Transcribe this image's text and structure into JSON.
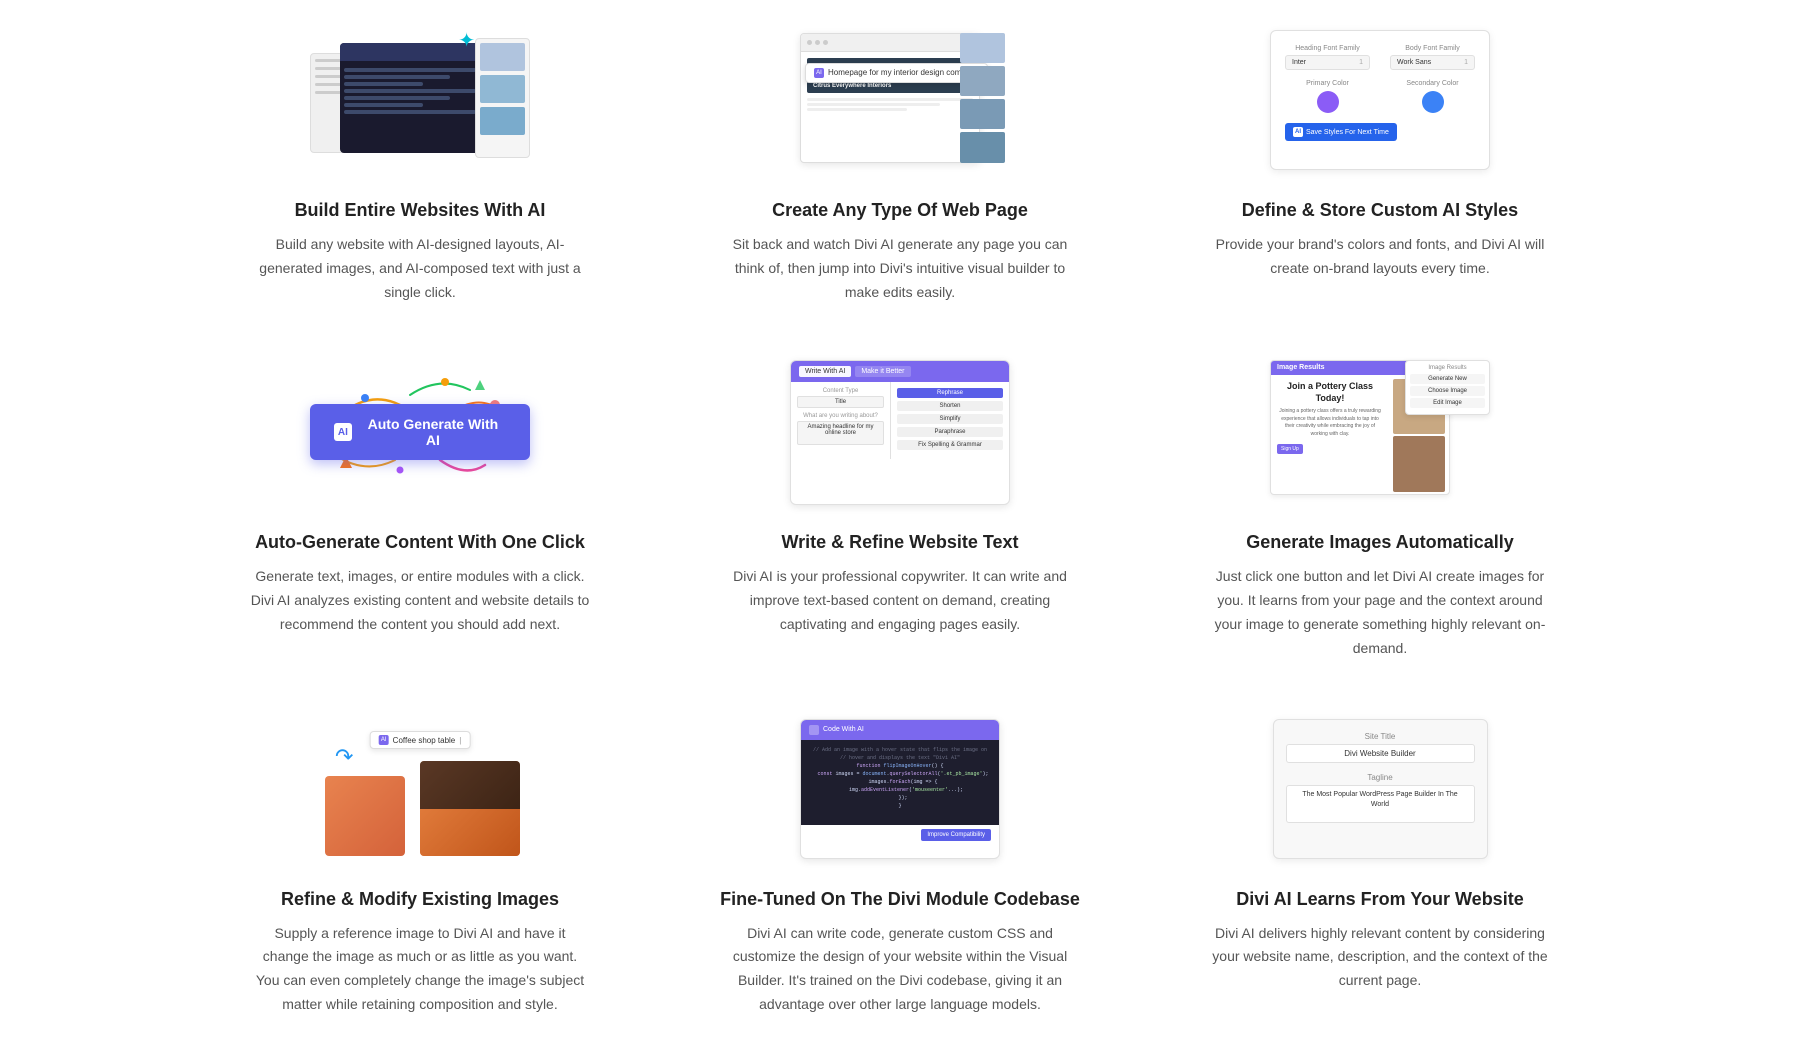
{
  "cards": [
    {
      "id": "build-websites",
      "title": "Build Entire Websites With AI",
      "description": "Build any website with AI-designed layouts, AI-generated images, and AI-composed text with just a single click."
    },
    {
      "id": "create-webpage",
      "title": "Create Any Type Of Web Page",
      "description": "Sit back and watch Divi AI generate any page you can think of, then jump into Divi's intuitive visual builder to make edits easily."
    },
    {
      "id": "define-styles",
      "title": "Define & Store Custom AI Styles",
      "description": "Provide your brand's colors and fonts, and Divi AI will create on-brand layouts every time."
    },
    {
      "id": "auto-generate",
      "title": "Auto-Generate Content With One Click",
      "description": "Generate text, images, or entire modules with a click. Divi AI analyzes existing content and website details to recommend the content you should add next."
    },
    {
      "id": "write-refine",
      "title": "Write & Refine Website Text",
      "description": "Divi AI is your professional copywriter. It can write and improve text-based content on demand, creating captivating and engaging pages easily."
    },
    {
      "id": "generate-images",
      "title": "Generate Images Automatically",
      "description": "Just click one button and let Divi AI create images for you. It learns from your page and the context around your image to generate something highly relevant on-demand."
    },
    {
      "id": "refine-images",
      "title": "Refine & Modify Existing Images",
      "description": "Supply a reference image to Divi AI and have it change the image as much or as little as you want. You can even completely change the image's subject matter while retaining composition and style."
    },
    {
      "id": "fine-tuned",
      "title": "Fine-Tuned On The Divi Module Codebase",
      "description": "Divi AI can write code, generate custom CSS and customize the design of your website within the Visual Builder. It's trained on the Divi codebase, giving it an advantage over other large language models."
    },
    {
      "id": "learns-website",
      "title": "Divi AI Learns From Your Website",
      "description": "Divi AI delivers highly relevant content by considering your website name, description, and the context of the current page."
    }
  ],
  "ui": {
    "auto_generate_btn": "Auto Generate With AI",
    "ai_icon": "AI",
    "write_with_ai": "Write With AI",
    "make_it_better": "Make it Better",
    "rephrase": "Rephrase",
    "content_type": "Content Type",
    "content_type_value": "Title",
    "what_writing": "What are you writing about?",
    "what_writing_value": "Amazing headline for my online store",
    "heading_font": "Heading Font Family",
    "body_font": "Body Font Family",
    "heading_font_value": "Inter",
    "body_font_value": "Work Sans",
    "primary_color": "Primary Color",
    "secondary_color": "Secondary Color",
    "primary_color_hex": "#8b5cf6",
    "secondary_color_hex": "#3b82f6",
    "save_styles_btn": "Save Styles For Next Time",
    "browser_prompt": "Homepage for my interior design company",
    "coffee_prompt": "Coffee shop table",
    "code_with_ai": "Code With AI",
    "improve_compatibility": "Improve Compatibility",
    "site_title_label": "Site Title",
    "site_title_value": "Divi Website Builder",
    "tagline_label": "Tagline",
    "tagline_value": "The Most Popular WordPress Page Builder In The World",
    "pottery_title": "Join a Pottery Class Today!",
    "image_results": "Image Results"
  }
}
